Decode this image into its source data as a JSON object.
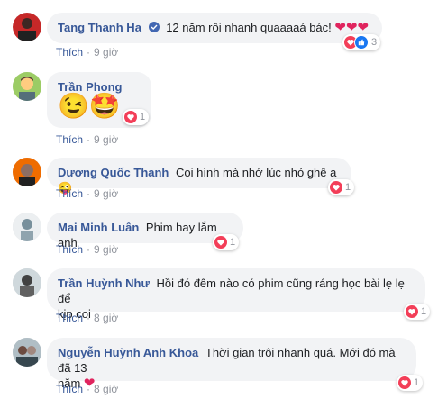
{
  "comments": [
    {
      "author": "Tang Thanh Ha",
      "verified": true,
      "text": "12 năm rồi nhanh quaaaaá bác!",
      "hearts": 3,
      "reaction_count": "3",
      "like_label": "Thích",
      "time": "9 giờ"
    },
    {
      "author": "Trần Phong",
      "text": "",
      "emojis": "😉🤩",
      "reaction_count": "1",
      "like_label": "Thích",
      "time": "9 giờ"
    },
    {
      "author": "Dương Quốc Thanh",
      "text": "Coi hình mà nhớ lúc nhỏ ghê a 😜",
      "reaction_count": "1",
      "like_label": "Thích",
      "time": "9 giờ"
    },
    {
      "author": "Mai Minh Luân",
      "text": "Phim hay lắm anh",
      "reaction_count": "1",
      "like_label": "Thích",
      "time": "9 giờ"
    },
    {
      "author": "Trần Huỳnh Như",
      "text": "Hồi đó đêm nào có phim cũng ráng học bài lẹ lẹ để",
      "text2": "kịp coi",
      "reaction_count": "1",
      "like_label": "Thích",
      "time": "8 giờ"
    },
    {
      "author": "Nguyễn Huỳnh Anh Khoa",
      "text": "Thời gian trôi nhanh quá. Mới đó mà đã 13",
      "text2": "năm",
      "reaction_count": "1",
      "like_label": "Thích",
      "time": "8 giờ"
    }
  ],
  "separator": "·",
  "colors": {
    "link": "#385898",
    "heart": "#e0245e",
    "bubble": "#f2f3f5",
    "meta": "#90949c"
  }
}
